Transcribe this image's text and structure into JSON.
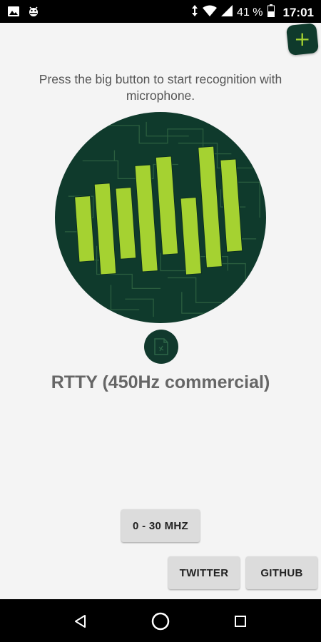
{
  "status_bar": {
    "battery": "41 %",
    "time": "17:01",
    "icons": [
      "image-icon",
      "android-debug-icon",
      "data-arrows-icon",
      "wifi-icon",
      "signal-icon",
      "battery-icon"
    ]
  },
  "header": {
    "add_button_symbol": "+",
    "add_button_icon": "plus-icon"
  },
  "main": {
    "instruction": "Press the big button to start recognition with microphone.",
    "mode_label": "RTTY (450Hz commercial)",
    "big_button_icon": "spectrum-bars-icon",
    "mode_icon": "document-icon"
  },
  "buttons": {
    "range": "0 - 30 MHZ",
    "twitter": "TWITTER",
    "github": "GITHUB"
  },
  "nav": {
    "back": "back-icon",
    "home": "home-icon",
    "recents": "recents-icon"
  },
  "colors": {
    "accent_green": "#a5d231",
    "dark_green": "#0f3a2c",
    "background": "#f4f4f4"
  }
}
